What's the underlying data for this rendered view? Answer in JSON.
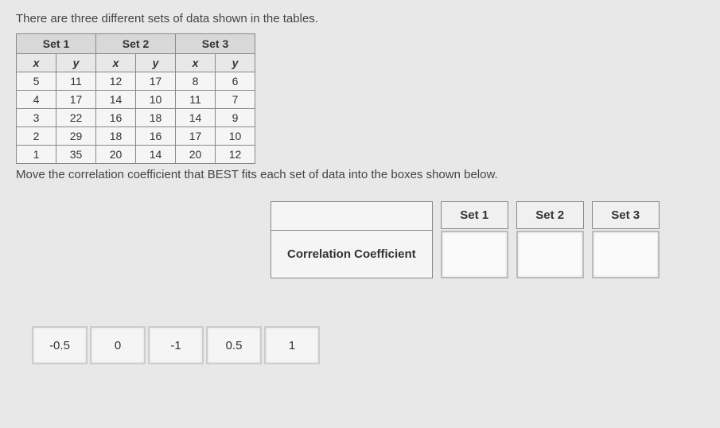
{
  "instruction1": "There are three different sets of data shown in the tables.",
  "instruction2": "Move the correlation coefficient that BEST fits each set of data into the boxes shown below.",
  "sets": {
    "headers": [
      "Set 1",
      "Set 2",
      "Set 3"
    ],
    "cols": [
      "x",
      "y",
      "x",
      "y",
      "x",
      "y"
    ],
    "rows": [
      [
        "5",
        "11",
        "12",
        "17",
        "8",
        "6"
      ],
      [
        "4",
        "17",
        "14",
        "10",
        "11",
        "7"
      ],
      [
        "3",
        "22",
        "16",
        "18",
        "14",
        "9"
      ],
      [
        "2",
        "29",
        "18",
        "16",
        "17",
        "10"
      ],
      [
        "1",
        "35",
        "20",
        "14",
        "20",
        "12"
      ]
    ]
  },
  "answer": {
    "row_label": "Correlation Coefficient",
    "columns": [
      "Set 1",
      "Set 2",
      "Set 3"
    ]
  },
  "chips": [
    "-0.5",
    "0",
    "-1",
    "0.5",
    "1"
  ],
  "chart_data": [
    {
      "type": "table",
      "name": "Set 1",
      "x": [
        5,
        4,
        3,
        2,
        1
      ],
      "y": [
        11,
        17,
        22,
        29,
        35
      ]
    },
    {
      "type": "table",
      "name": "Set 2",
      "x": [
        12,
        14,
        16,
        18,
        20
      ],
      "y": [
        17,
        10,
        18,
        16,
        14
      ]
    },
    {
      "type": "table",
      "name": "Set 3",
      "x": [
        8,
        11,
        14,
        17,
        20
      ],
      "y": [
        6,
        7,
        9,
        10,
        12
      ]
    }
  ]
}
